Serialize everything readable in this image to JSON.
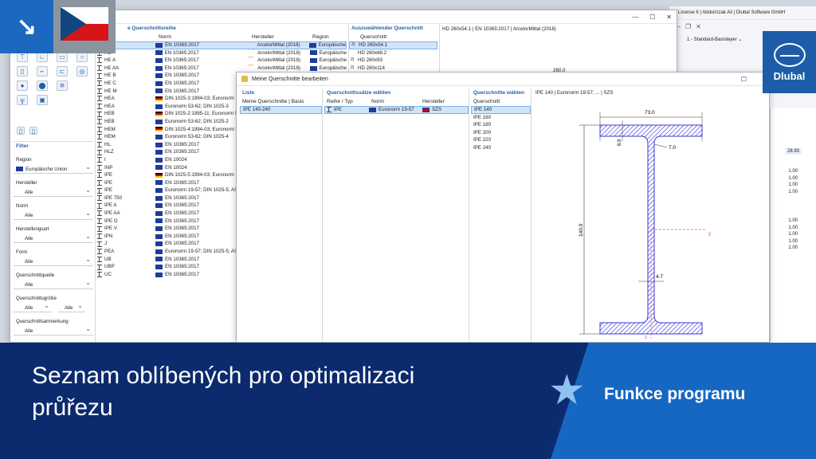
{
  "main_window": {
    "title": "e License 6 | Abdulrzzak Ali | Dlubal Software GmbH",
    "layer_dropdown": "1 - Standard-Basislayer",
    "value_28": "28.93",
    "values_a": [
      "1.00",
      "1.00",
      "1.00",
      "1.00"
    ],
    "values_b": [
      "1.00",
      "1.00",
      "1.00",
      "1.00",
      "1.00"
    ]
  },
  "library": {
    "section_title": "e Querschnittsreihe",
    "columns": {
      "norm": "Norm",
      "hersteller": "Hersteller",
      "region": "Region"
    },
    "rows": [
      {
        "name": "",
        "norm": "EN 10365:2017",
        "flag": "eu",
        "hersteller": "ArcelorMittal (2018)",
        "region": "Europäische",
        "sel": true
      },
      {
        "name": "HE",
        "norm": "EN 10365:2017",
        "flag": "eu",
        "hersteller": "ArcelorMittal (2018)",
        "region": "Europäische"
      },
      {
        "name": "HE A",
        "norm": "EN 10365:2017",
        "flag": "eu",
        "hersteller": "ArcelorMittal (2018)",
        "region": "Europäische"
      },
      {
        "name": "HE AA",
        "norm": "EN 10365:2017",
        "flag": "eu",
        "hersteller": "ArcelorMittal (2018)",
        "region": "Europäische"
      },
      {
        "name": "HE B",
        "norm": "EN 10365:2017",
        "flag": "eu",
        "hersteller": "",
        "region": ""
      },
      {
        "name": "HE C",
        "norm": "EN 10365:2017",
        "flag": "eu",
        "hersteller": "",
        "region": ""
      },
      {
        "name": "HE M",
        "norm": "EN 10365:2017",
        "flag": "eu",
        "hersteller": "",
        "region": ""
      },
      {
        "name": "HEA",
        "norm": "DIN 1025-3:1994-03; Euronorm 1",
        "flag": "de",
        "hersteller": "",
        "region": ""
      },
      {
        "name": "HEA",
        "norm": "Euronorm 53-62; DIN 1025-3",
        "flag": "eu",
        "hersteller": "",
        "region": ""
      },
      {
        "name": "HEB",
        "norm": "DIN 1025-2:1995-11; Euronorm 5",
        "flag": "de",
        "hersteller": "",
        "region": ""
      },
      {
        "name": "HEB",
        "norm": "Euronorm 53-62; DIN 1025-2",
        "flag": "eu",
        "hersteller": "",
        "region": ""
      },
      {
        "name": "HEM",
        "norm": "DIN 1025-4:1994-03; Euronorm 5",
        "flag": "de",
        "hersteller": "",
        "region": ""
      },
      {
        "name": "HEM",
        "norm": "Euronorm 53-62; DIN 1025-4",
        "flag": "eu",
        "hersteller": "",
        "region": ""
      },
      {
        "name": "HL",
        "norm": "EN 10365:2017",
        "flag": "eu",
        "hersteller": "",
        "region": ""
      },
      {
        "name": "HLZ",
        "norm": "EN 10365:2017",
        "flag": "eu",
        "hersteller": "",
        "region": ""
      },
      {
        "name": "I",
        "norm": "EN 10024",
        "flag": "eu",
        "hersteller": "",
        "region": ""
      },
      {
        "name": "INP",
        "norm": "EN 10024",
        "flag": "eu",
        "hersteller": "",
        "region": ""
      },
      {
        "name": "IPE",
        "norm": "DIN 1025-5:1994-03; Euronorm 1",
        "flag": "de",
        "hersteller": "",
        "region": ""
      },
      {
        "name": "IPE",
        "norm": "EN 10365:2017",
        "flag": "eu",
        "hersteller": "",
        "region": ""
      },
      {
        "name": "IPE",
        "norm": "Euronorm 19-57; DIN 1025-5; AS",
        "flag": "eu",
        "hersteller": "",
        "region": ""
      },
      {
        "name": "IPE 750",
        "norm": "EN 10365:2017",
        "flag": "eu",
        "hersteller": "",
        "region": ""
      },
      {
        "name": "IPE A",
        "norm": "EN 10365:2017",
        "flag": "eu",
        "hersteller": "",
        "region": ""
      },
      {
        "name": "IPE AA",
        "norm": "EN 10365:2017",
        "flag": "eu",
        "hersteller": "",
        "region": ""
      },
      {
        "name": "IPE O",
        "norm": "EN 10365:2017",
        "flag": "eu",
        "hersteller": "",
        "region": ""
      },
      {
        "name": "IPE V",
        "norm": "EN 10365:2017",
        "flag": "eu",
        "hersteller": "",
        "region": ""
      },
      {
        "name": "IPN",
        "norm": "EN 10365:2017",
        "flag": "eu",
        "hersteller": "",
        "region": ""
      },
      {
        "name": "J",
        "norm": "EN 10365:2017",
        "flag": "eu",
        "hersteller": "",
        "region": ""
      },
      {
        "name": "PEA",
        "norm": "Euronorm 19-57; DIN 1025-5; AS",
        "flag": "eu",
        "hersteller": "",
        "region": ""
      },
      {
        "name": "UB",
        "norm": "EN 10365:2017",
        "flag": "eu",
        "hersteller": "",
        "region": ""
      },
      {
        "name": "UBP",
        "norm": "EN 10365:2017",
        "flag": "eu",
        "hersteller": "",
        "region": ""
      },
      {
        "name": "UC",
        "norm": "EN 10365:2017",
        "flag": "eu",
        "hersteller": "",
        "region": ""
      }
    ]
  },
  "picker": {
    "section_title": "Auszuwählender Querschnitt",
    "column": "Querschnitt",
    "rows": [
      {
        "num": "2)",
        "name": "HD 260x54.1",
        "sel": true
      },
      {
        "num": "",
        "name": "HD 260x68.2"
      },
      {
        "num": "2)",
        "name": "HD 260x93"
      },
      {
        "num": "2)",
        "name": "HD 260x114"
      }
    ],
    "preview_title": "HD 260x54.1 | EN 10365:2017 | ArcelorMittal (2018)",
    "preview_dim": "260.0"
  },
  "filter": {
    "title": "Filter",
    "fields": [
      {
        "label": "Region",
        "value": "Europäische Union",
        "flag": true
      },
      {
        "label": "Hersteller",
        "value": "Alle"
      },
      {
        "label": "Norm",
        "value": "Alle"
      },
      {
        "label": "Herstellungsart",
        "value": "Alle"
      },
      {
        "label": "Form",
        "value": "Alle"
      },
      {
        "label": "Querschnittquelle",
        "value": "Alle"
      }
    ],
    "size_label": "Querschnittsgröße",
    "size_from": "Alle",
    "size_to": "Alle",
    "note_label": "Querschnittsanmerkung",
    "note_value": "Alle"
  },
  "dialog": {
    "title": "Meine Querschnitte bearbeiten",
    "liste": {
      "title": "Liste",
      "header": "Meine Querschnitte | Basis",
      "item": "IPE 140-240"
    },
    "sets": {
      "title": "Querschnittssätze wählen",
      "col_reihe": "Reihe / Typ",
      "col_norm": "Norm",
      "col_hersteller": "Hersteller",
      "row": {
        "name": "IPE",
        "norm": "Euronorm 19-57",
        "hersteller": "SZS"
      }
    },
    "sections": {
      "title": "Querschnitte wählen",
      "column": "Querschnitt",
      "items": [
        "IPE 140",
        "IPE 160",
        "IPE 180",
        "IPE 200",
        "IPE 220",
        "IPE 240"
      ]
    },
    "preview": {
      "title": "IPE 140 | Euronorm 19-57; ... | SZS",
      "width": "73.0",
      "height": "140.0",
      "flange": "6.9",
      "radius": "7.0",
      "web": "4.7",
      "axis_y": "y",
      "axis_z": "z"
    }
  },
  "banner": {
    "title_line1": "Seznam oblíbených pro optimalizaci",
    "title_line2": "průřezu",
    "tag": "Funkce programu",
    "brand": "Dlubal",
    "colors": {
      "dark": "#0c2a6e",
      "light": "#1667c2",
      "star": "#8fc3ef",
      "logo_bg": "#1c5ca8"
    }
  }
}
